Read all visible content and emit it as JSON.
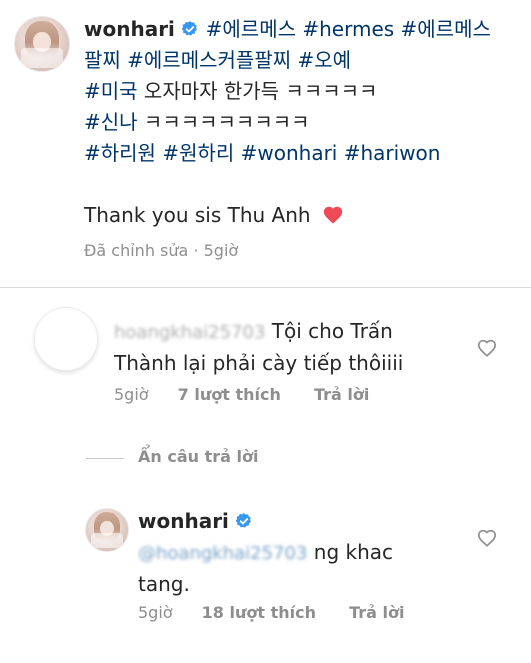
{
  "caption": {
    "username": "wonhari",
    "line1_tags": "#에르메스 #hermes #에르메스",
    "line2_tags": "팔찌 #에르메스커플팔찌 #오예",
    "line3_tag": "#미국",
    "line3_text": " 오자마자 한가득 ㅋㅋㅋㅋㅋ",
    "line4_tag": "#신나",
    "line4_text": " ㅋㅋㅋㅋㅋㅋㅋㅋㅋ",
    "line5_tags": "#하리원 #원하리 #wonhari #hariwon",
    "thanks": "Thank you sis Thu Anh",
    "heart_emoji": "❤️",
    "edited": "Đã chỉnh sửa",
    "dot": "·",
    "time": "5giờ"
  },
  "comment1": {
    "username_blurred": "hoangkhai25703",
    "text_line1": "Tội cho Trấn",
    "text_line2": "Thành lại phải cày tiếp thôiiii",
    "time": "5giờ",
    "likes": "7 lượt thích",
    "reply": "Trả lời"
  },
  "hide_replies": "Ẩn câu trả lời",
  "reply1": {
    "username": "wonhari",
    "mention_blurred": "@hoangkhai25703",
    "text_after": " ng khac",
    "text_line2": "tang.",
    "time": "5giờ",
    "likes": "18 lượt thích",
    "reply": "Trả lời"
  },
  "icons": {
    "verified": "verified-badge-icon",
    "like": "heart-outline-icon",
    "emoji": "red-heart-icon",
    "avatar_default": "default-avatar-icon"
  },
  "colors": {
    "hashtag": "#003569",
    "verified": "#3897f0",
    "meta": "#8e8e8e",
    "heart": "#ed4956"
  }
}
